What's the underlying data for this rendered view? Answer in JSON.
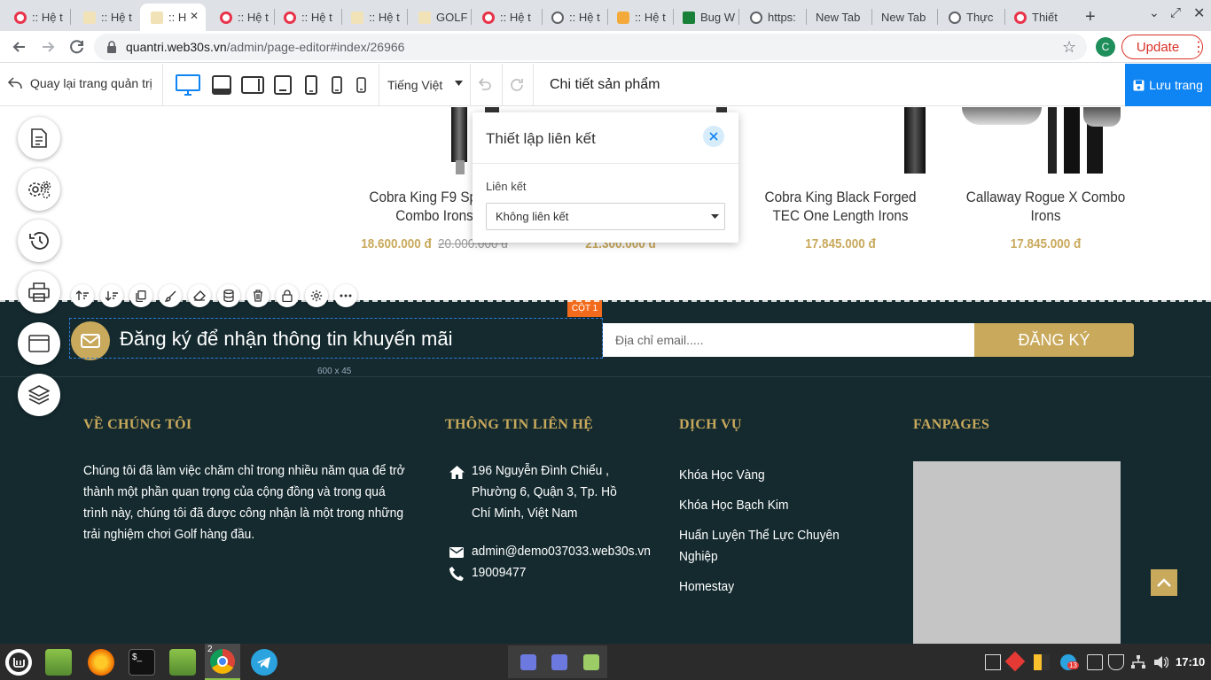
{
  "browser": {
    "tabs": [
      {
        "title": ":: Hệ t",
        "fav": "red"
      },
      {
        "title": ":: Hệ t",
        "fav": "gold"
      },
      {
        "title": ":: H",
        "fav": "gold"
      },
      {
        "title": ":: Hệ t",
        "fav": "red"
      },
      {
        "title": ":: Hệ t",
        "fav": "red"
      },
      {
        "title": ":: Hệ t",
        "fav": "gold"
      },
      {
        "title": "GOLF",
        "fav": "gold"
      },
      {
        "title": ":: Hệ t",
        "fav": "red"
      },
      {
        "title": ":: Hệ t",
        "fav": "globe"
      },
      {
        "title": ":: Hệ t",
        "fav": "orange"
      },
      {
        "title": "Bug W",
        "fav": "sheet"
      },
      {
        "title": "https:",
        "fav": "globe"
      },
      {
        "title": "New Tab",
        "fav": "none"
      },
      {
        "title": "New Tab",
        "fav": "none"
      },
      {
        "title": "Thực",
        "fav": "globe"
      },
      {
        "title": "Thiết",
        "fav": "red"
      }
    ],
    "url_domain": "quantri.web30s.vn",
    "url_path": "/admin/page-editor#index/26966",
    "avatar_letter": "C",
    "update_label": "Update"
  },
  "editor": {
    "back_label": "Quay lại trang quản trị",
    "language": "Tiếng Việt",
    "page_title": "Chi tiết sản phẩm",
    "save_label": "Lưu trang"
  },
  "products": [
    {
      "name": "Cobra King F9 Speed Combo Irons",
      "price": "18.600.000 đ",
      "old_price": "20.000.000 đ"
    },
    {
      "name": "",
      "price": "21.300.000 đ",
      "old_price": ""
    },
    {
      "name": "Cobra King Black Forged TEC One Length Irons",
      "price": "17.845.000 đ",
      "old_price": ""
    },
    {
      "name": "Callaway Rogue X Combo Irons",
      "price": "17.845.000 đ",
      "old_price": ""
    }
  ],
  "modal": {
    "title": "Thiết lập liên kết",
    "field_label": "Liên kết",
    "select_value": "Không liên kết"
  },
  "newsletter": {
    "text": "Đăng ký để nhận thông tin khuyến mãi",
    "column_badge": "CỘT 1",
    "size_label": "600 x 45",
    "email_placeholder": "Địa chỉ email.....",
    "subscribe_label": "ĐĂNG KÝ"
  },
  "footer": {
    "about": {
      "heading": "VỀ CHÚNG TÔI",
      "text": "Chúng tôi đã làm việc chăm chỉ trong nhiều năm qua để trở thành một phần quan trọng của cộng đồng và trong quá trình này, chúng tôi đã được công nhận là một trong những trải nghiệm chơi Golf hàng đầu."
    },
    "contact": {
      "heading": "THÔNG TIN LIÊN HỆ",
      "address": "196 Nguyễn Đình Chiểu , Phường 6, Quận 3, Tp. Hồ Chí Minh, Việt Nam",
      "email": "admin@demo037033.web30s.vn",
      "phone": "19009477"
    },
    "services": {
      "heading": "DỊCH VỤ",
      "items": [
        "Khóa Học Vàng",
        "Khóa Học Bạch Kim",
        "Huấn Luyện Thể Lực Chuyên Nghiệp",
        "Homestay"
      ]
    },
    "fanpages": {
      "heading": "FANPAGES"
    }
  },
  "taskbar": {
    "chrome_badge": "2",
    "tray_badge": "13",
    "clock": "17:10"
  }
}
